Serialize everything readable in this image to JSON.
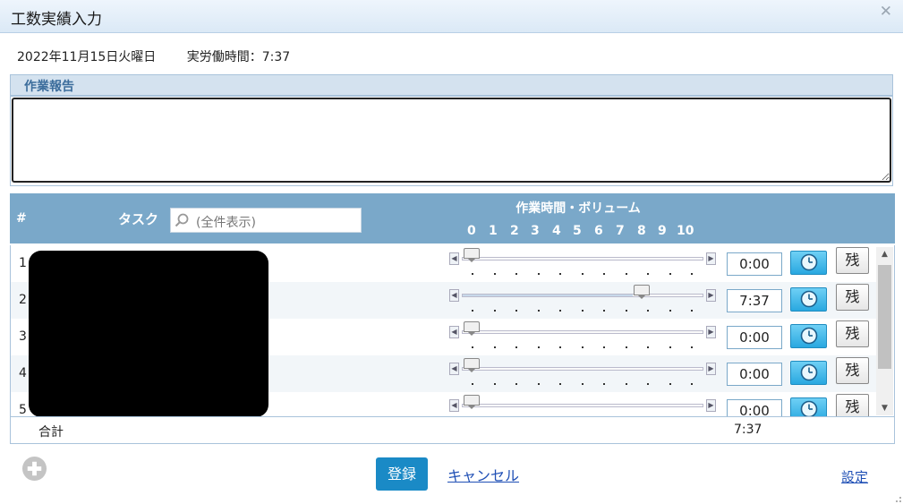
{
  "dialog": {
    "title": "工数実績入力"
  },
  "info": {
    "date": "2022年11月15日火曜日",
    "actual_hours": "実労働時間：7:37"
  },
  "report": {
    "header": "作業報告",
    "text": ""
  },
  "grid": {
    "hash": "#",
    "task_label": "タスク",
    "search_placeholder": "(全件表示)",
    "volume_title": "作業時間・ボリューム",
    "scale": [
      "0",
      "1",
      "2",
      "3",
      "4",
      "5",
      "6",
      "7",
      "8",
      "9",
      "10"
    ],
    "rows": [
      {
        "num": "1",
        "time": "0:00",
        "level": 0,
        "zan": "残"
      },
      {
        "num": "2",
        "time": "7:37",
        "level": 0.76,
        "zan": "残"
      },
      {
        "num": "3",
        "time": "0:00",
        "level": 0,
        "zan": "残"
      },
      {
        "num": "4",
        "time": "0:00",
        "level": 0,
        "zan": "残"
      },
      {
        "num": "5",
        "time": "0:00",
        "level": 0,
        "zan": "残"
      }
    ]
  },
  "footer": {
    "total_label": "合計",
    "total_value": "7:37"
  },
  "actions": {
    "register": "登録",
    "cancel": "キャンセル",
    "settings": "設定"
  },
  "colors": {
    "accent": "#1a8ac6",
    "header": "#7aa8c9",
    "link": "#1f4fb5"
  }
}
